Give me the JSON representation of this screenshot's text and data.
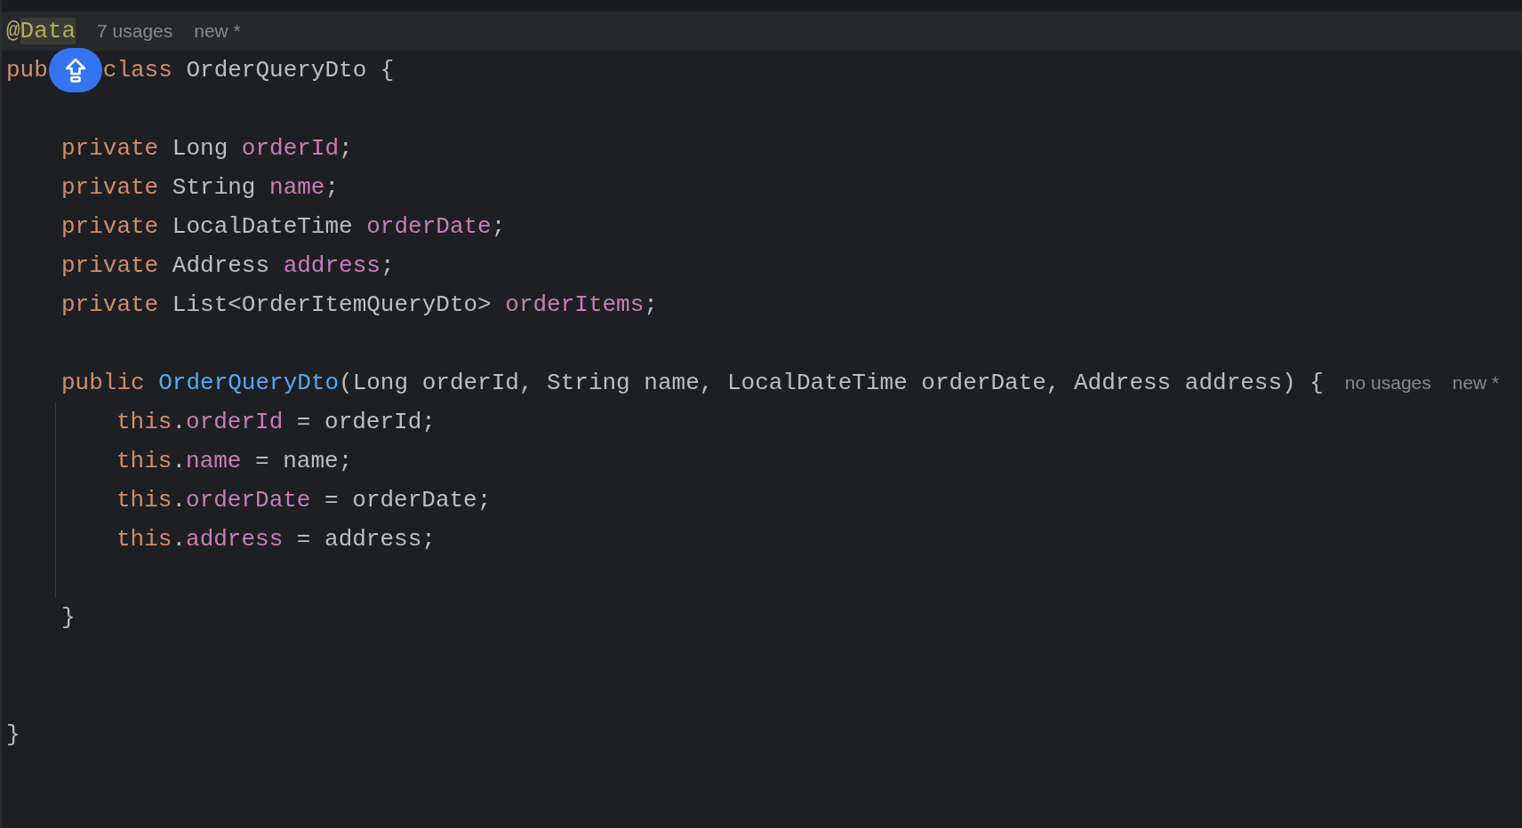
{
  "editor": {
    "lines": [
      {
        "kind": "annotation",
        "tokens": [
          {
            "text": "@",
            "kind": "annotation",
            "highlighted": false
          },
          {
            "text": "Data",
            "kind": "annotation",
            "highlighted": true
          }
        ],
        "hints": [
          "7 usages",
          "new *"
        ]
      },
      {
        "kind": "code",
        "tokens": [
          {
            "text": "pub",
            "kind": "keyword"
          },
          {
            "kind": "badge"
          },
          {
            "text": "class ",
            "kind": "keyword"
          },
          {
            "text": "OrderQueryDto {",
            "kind": "plain"
          }
        ],
        "children": [
          {
            "kind": "blank"
          },
          {
            "kind": "code",
            "tokens": [
              {
                "text": "private ",
                "kind": "keyword"
              },
              {
                "text": "Long ",
                "kind": "plain"
              },
              {
                "text": "orderId",
                "kind": "field"
              },
              {
                "text": ";",
                "kind": "plain"
              }
            ]
          },
          {
            "kind": "code",
            "tokens": [
              {
                "text": "private ",
                "kind": "keyword"
              },
              {
                "text": "String ",
                "kind": "plain"
              },
              {
                "text": "name",
                "kind": "field"
              },
              {
                "text": ";",
                "kind": "plain"
              }
            ]
          },
          {
            "kind": "code",
            "tokens": [
              {
                "text": "private ",
                "kind": "keyword"
              },
              {
                "text": "LocalDateTime ",
                "kind": "plain"
              },
              {
                "text": "orderDate",
                "kind": "field"
              },
              {
                "text": ";",
                "kind": "plain"
              }
            ]
          },
          {
            "kind": "code",
            "tokens": [
              {
                "text": "private ",
                "kind": "keyword"
              },
              {
                "text": "Address ",
                "kind": "plain"
              },
              {
                "text": "address",
                "kind": "field"
              },
              {
                "text": ";",
                "kind": "plain"
              }
            ]
          },
          {
            "kind": "code",
            "tokens": [
              {
                "text": "private ",
                "kind": "keyword"
              },
              {
                "text": "List<OrderItemQueryDto> ",
                "kind": "plain"
              },
              {
                "text": "orderItems",
                "kind": "field"
              },
              {
                "text": ";",
                "kind": "plain"
              }
            ]
          },
          {
            "kind": "blank"
          },
          {
            "kind": "code",
            "tokens": [
              {
                "text": "public ",
                "kind": "keyword"
              },
              {
                "text": "OrderQueryDto",
                "kind": "method"
              },
              {
                "text": "(Long orderId, String name, LocalDateTime orderDate, Address address) {",
                "kind": "plain"
              }
            ],
            "hints": [
              "no usages",
              "new *"
            ],
            "children": [
              {
                "kind": "code",
                "tokens": [
                  {
                    "text": "this",
                    "kind": "keyword"
                  },
                  {
                    "text": ".",
                    "kind": "plain"
                  },
                  {
                    "text": "orderId",
                    "kind": "field"
                  },
                  {
                    "text": " = orderId;",
                    "kind": "plain"
                  }
                ]
              },
              {
                "kind": "code",
                "tokens": [
                  {
                    "text": "this",
                    "kind": "keyword"
                  },
                  {
                    "text": ".",
                    "kind": "plain"
                  },
                  {
                    "text": "name",
                    "kind": "field"
                  },
                  {
                    "text": " = name;",
                    "kind": "plain"
                  }
                ]
              },
              {
                "kind": "code",
                "tokens": [
                  {
                    "text": "this",
                    "kind": "keyword"
                  },
                  {
                    "text": ".",
                    "kind": "plain"
                  },
                  {
                    "text": "orderDate",
                    "kind": "field"
                  },
                  {
                    "text": " = orderDate;",
                    "kind": "plain"
                  }
                ]
              },
              {
                "kind": "code",
                "tokens": [
                  {
                    "text": "this",
                    "kind": "keyword"
                  },
                  {
                    "text": ".",
                    "kind": "plain"
                  },
                  {
                    "text": "address",
                    "kind": "field"
                  },
                  {
                    "text": " = address;",
                    "kind": "plain"
                  }
                ]
              },
              {
                "kind": "blank"
              }
            ]
          },
          {
            "kind": "code",
            "tokens": [
              {
                "text": "}",
                "kind": "plain"
              }
            ]
          },
          {
            "kind": "blank"
          },
          {
            "kind": "blank"
          }
        ]
      },
      {
        "kind": "code",
        "tokens": [
          {
            "text": "}",
            "kind": "plain"
          }
        ]
      }
    ]
  }
}
